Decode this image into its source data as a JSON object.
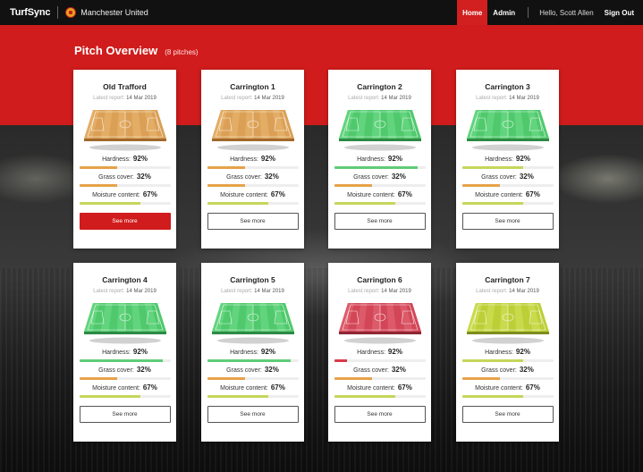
{
  "brand": "TurfSync",
  "club": "Manchester United",
  "nav": {
    "home": "Home",
    "admin": "Admin",
    "user": "Hello, Scott Allen",
    "signout": "Sign Out"
  },
  "page": {
    "title": "Pitch Overview",
    "count": "(8 pitches)"
  },
  "colors": {
    "accent": "#d01c1c",
    "pitch_orange": "#d99a47",
    "pitch_green": "#52c970",
    "pitch_red": "#d24a5a",
    "pitch_lime": "#b9cf35"
  },
  "labels": {
    "hardness": "Hardness:",
    "grass": "Grass cover:",
    "moisture": "Moisture content:",
    "report_prefix": "Latest report:",
    "button": "See more"
  },
  "pitches": [
    {
      "name": "Old Trafford",
      "report": "14 Mar 2019",
      "status": "orange",
      "hardness": "92%",
      "grass": "32%",
      "moisture": "67%",
      "hardness_fill": 0.42,
      "hardness_color": "#e6a24a",
      "grass_fill": 0.42,
      "grass_color": "#e6a24a",
      "moisture_fill": 0.67,
      "moisture_color": "#c6d65a",
      "primary": true
    },
    {
      "name": "Carrington 1",
      "report": "14 Mar 2019",
      "status": "orange",
      "hardness": "92%",
      "grass": "32%",
      "moisture": "67%",
      "hardness_fill": 0.42,
      "hardness_color": "#e6a24a",
      "grass_fill": 0.42,
      "grass_color": "#e6a24a",
      "moisture_fill": 0.67,
      "moisture_color": "#c6d65a",
      "primary": false
    },
    {
      "name": "Carrington 2",
      "report": "14 Mar 2019",
      "status": "green",
      "hardness": "92%",
      "grass": "32%",
      "moisture": "67%",
      "hardness_fill": 0.92,
      "hardness_color": "#5fcc78",
      "grass_fill": 0.42,
      "grass_color": "#e6a24a",
      "moisture_fill": 0.67,
      "moisture_color": "#c6d65a",
      "primary": false
    },
    {
      "name": "Carrington 3",
      "report": "14 Mar 2019",
      "status": "green",
      "hardness": "92%",
      "grass": "32%",
      "moisture": "67%",
      "hardness_fill": 0.67,
      "hardness_color": "#c6d65a",
      "grass_fill": 0.42,
      "grass_color": "#e6a24a",
      "moisture_fill": 0.67,
      "moisture_color": "#c6d65a",
      "primary": false
    },
    {
      "name": "Carrington 4",
      "report": "14 Mar 2019",
      "status": "green",
      "hardness": "92%",
      "grass": "32%",
      "moisture": "67%",
      "hardness_fill": 0.92,
      "hardness_color": "#5fcc78",
      "grass_fill": 0.42,
      "grass_color": "#e6a24a",
      "moisture_fill": 0.67,
      "moisture_color": "#c6d65a",
      "primary": false
    },
    {
      "name": "Carrington 5",
      "report": "14 Mar 2019",
      "status": "green",
      "hardness": "92%",
      "grass": "32%",
      "moisture": "67%",
      "hardness_fill": 0.92,
      "hardness_color": "#5fcc78",
      "grass_fill": 0.42,
      "grass_color": "#e6a24a",
      "moisture_fill": 0.67,
      "moisture_color": "#c6d65a",
      "primary": false
    },
    {
      "name": "Carrington 6",
      "report": "14 Mar 2019",
      "status": "red",
      "hardness": "92%",
      "grass": "32%",
      "moisture": "67%",
      "hardness_fill": 0.14,
      "hardness_color": "#d83a4a",
      "grass_fill": 0.42,
      "grass_color": "#e6a24a",
      "moisture_fill": 0.67,
      "moisture_color": "#c6d65a",
      "primary": false
    },
    {
      "name": "Carrington 7",
      "report": "14 Mar 2019",
      "status": "lime",
      "hardness": "92%",
      "grass": "32%",
      "moisture": "67%",
      "hardness_fill": 0.67,
      "hardness_color": "#c6d65a",
      "grass_fill": 0.42,
      "grass_color": "#e6a24a",
      "moisture_fill": 0.67,
      "moisture_color": "#c6d65a",
      "primary": false
    }
  ]
}
